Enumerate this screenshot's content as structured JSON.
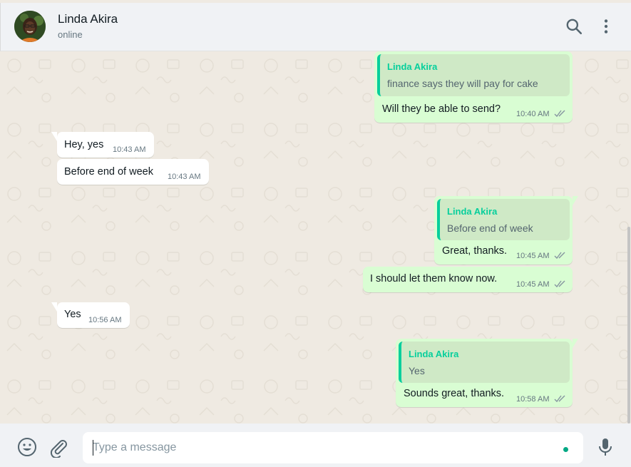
{
  "header": {
    "contact_name": "Linda Akira",
    "status": "online",
    "icons": [
      "search-icon",
      "menu-icon"
    ]
  },
  "messages": [
    {
      "direction": "outgoing",
      "quote": {
        "author": "Linda Akira",
        "text": "finance says they will pay for cake"
      },
      "text": "Will they be able to send?",
      "time": "10:40 AM",
      "read": true
    },
    {
      "direction": "incoming",
      "text": "Hey, yes",
      "time": "10:43 AM"
    },
    {
      "direction": "incoming",
      "text": "Before end of week",
      "time": "10:43 AM"
    },
    {
      "direction": "outgoing",
      "quote": {
        "author": "Linda Akira",
        "text": "Before end of week"
      },
      "text": "Great, thanks.",
      "time": "10:45 AM",
      "read": true
    },
    {
      "direction": "outgoing",
      "text": "I should let them know now.",
      "time": "10:45 AM",
      "read": true
    },
    {
      "direction": "incoming",
      "text": "Yes",
      "time": "10:56 AM"
    },
    {
      "direction": "outgoing",
      "quote": {
        "author": "Linda Akira",
        "text": "Yes"
      },
      "text": "Sounds great, thanks.",
      "time": "10:58 AM",
      "read": true
    }
  ],
  "composer": {
    "placeholder": "Type a message",
    "icons": [
      "emoji-icon",
      "attach-icon",
      "microphone-icon"
    ]
  },
  "colors": {
    "outgoing_bubble": "#d9fdd3",
    "incoming_bubble": "#ffffff",
    "quote_accent": "#06cf9c",
    "read_ticks": "#8696a0",
    "chat_background": "#efeae2"
  }
}
